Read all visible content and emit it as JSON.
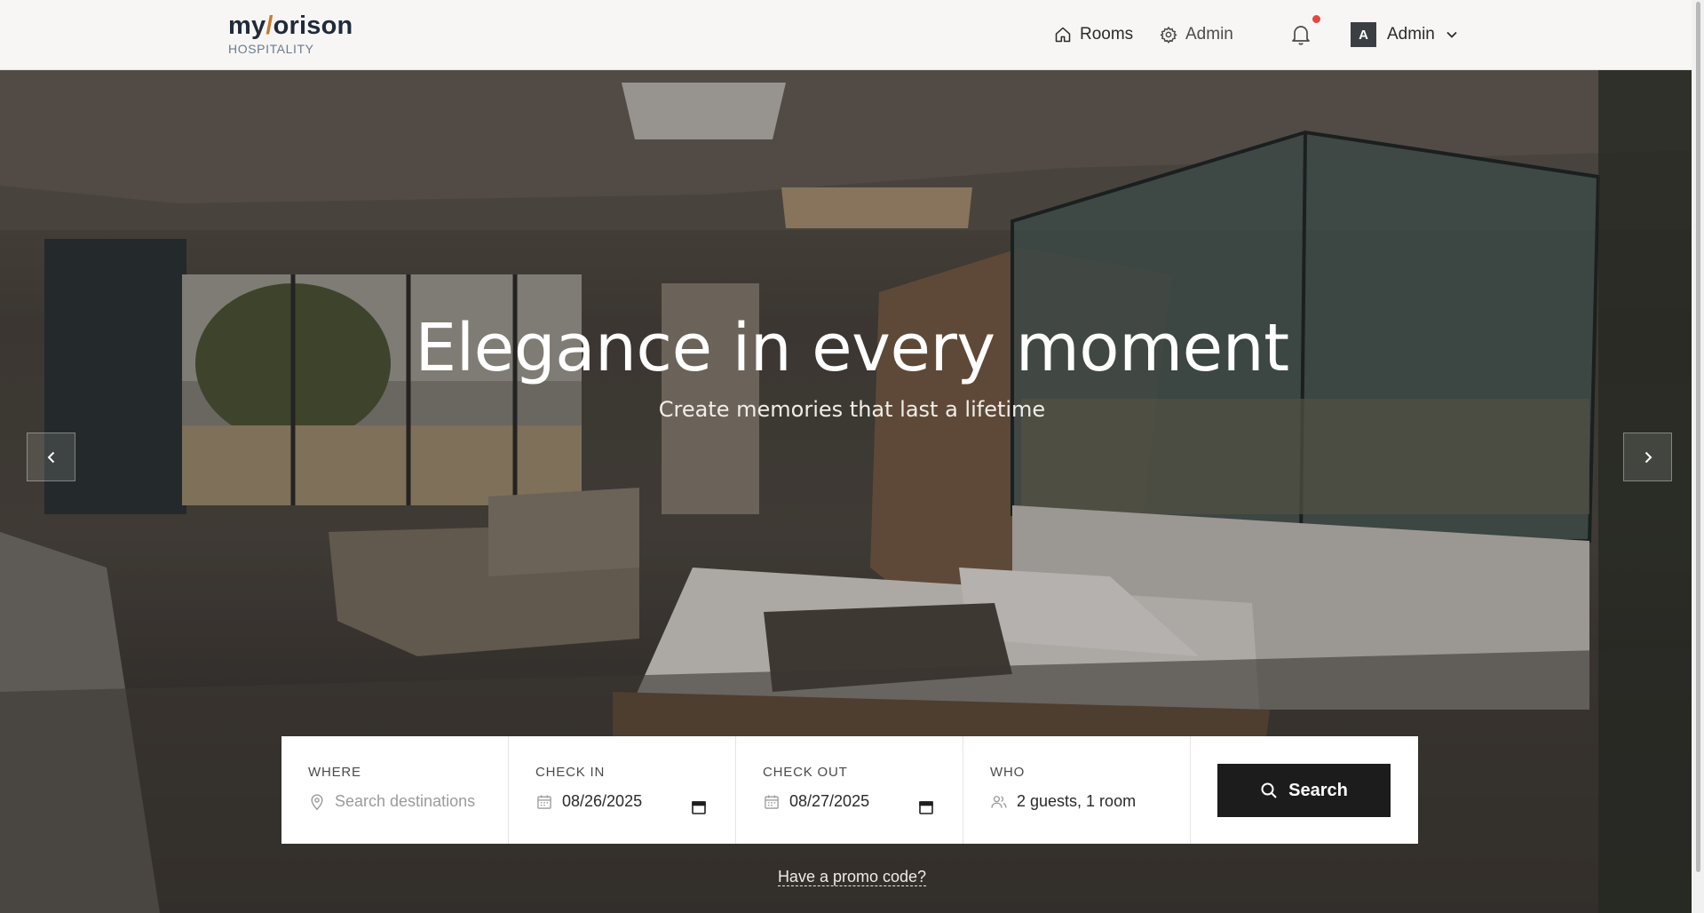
{
  "brand": {
    "name_left": "my",
    "name_slash": "/",
    "name_right": "orison",
    "subtitle": "HOSPITALITY"
  },
  "nav": {
    "rooms_label": "Rooms",
    "admin_label": "Admin",
    "user_initial": "A",
    "user_name": "Admin"
  },
  "hero": {
    "title": "Elegance in every moment",
    "subtitle": "Create memories that last a lifetime"
  },
  "search": {
    "where_label": "WHERE",
    "where_placeholder": "Search destinations",
    "checkin_label": "CHECK IN",
    "checkin_value": "08/26/2025",
    "checkout_label": "CHECK OUT",
    "checkout_value": "08/27/2025",
    "who_label": "WHO",
    "who_value": "2 guests, 1 room",
    "button_label": "Search"
  },
  "promo_label": "Have a promo code?",
  "colors": {
    "accent": "#c9792c",
    "button": "#1c1c1c",
    "notification_dot": "#e2463f"
  },
  "icons": [
    "home-icon",
    "gear-icon",
    "bell-icon",
    "chevron-down-icon",
    "chevron-left-icon",
    "chevron-right-icon",
    "map-pin-icon",
    "calendar-icon",
    "users-icon",
    "search-icon"
  ]
}
